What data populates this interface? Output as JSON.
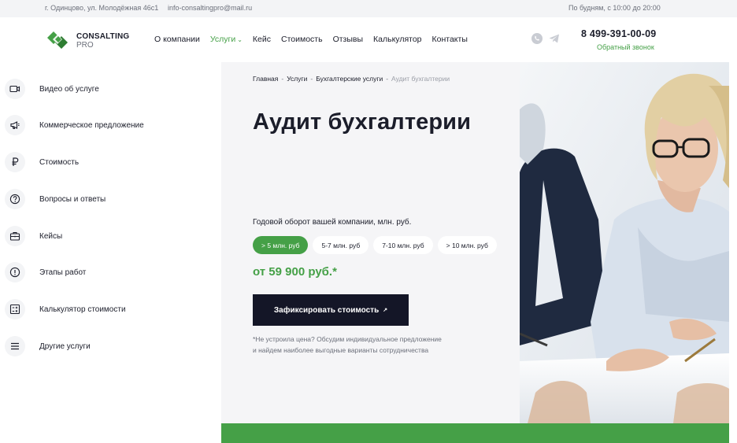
{
  "topbar": {
    "address": "г. Одинцово, ул. Молодёжная 46с1",
    "email": "info-consaltingpro@mail.ru",
    "hours": "По будням, с 10:00 до 20:00"
  },
  "logo": {
    "line1": "CONSALTING",
    "line2": "PRO"
  },
  "nav": {
    "items": [
      {
        "label": "О компании"
      },
      {
        "label": "Услуги",
        "active": true
      },
      {
        "label": "Кейс"
      },
      {
        "label": "Стоимость"
      },
      {
        "label": "Отзывы"
      },
      {
        "label": "Калькулятор"
      },
      {
        "label": "Контакты"
      }
    ]
  },
  "contact": {
    "phone": "8 499-391-00-09",
    "callback": "Обратный звонок"
  },
  "sidebar": {
    "items": [
      {
        "label": "Видео об услуге",
        "icon": "video-icon"
      },
      {
        "label": "Коммерческое предложение",
        "icon": "megaphone-icon"
      },
      {
        "label": "Стоимость",
        "icon": "ruble-icon"
      },
      {
        "label": "Вопросы и ответы",
        "icon": "question-icon"
      },
      {
        "label": "Кейсы",
        "icon": "briefcase-icon"
      },
      {
        "label": "Этапы работ",
        "icon": "info-icon"
      },
      {
        "label": "Калькулятор стоимости",
        "icon": "calculator-icon"
      },
      {
        "label": "Другие услуги",
        "icon": "menu-icon"
      }
    ]
  },
  "breadcrumbs": [
    "Главная",
    "Услуги",
    "Бухгалтерские услуги",
    "Аудит бухгалтерии"
  ],
  "hero": {
    "title": "Аудит бухгалтерии",
    "turnover_label": "Годовой оборот вашей компании, млн. руб.",
    "options": [
      "> 5 млн. руб",
      "5-7 млн. руб",
      "7-10 млн. руб",
      "> 10 млн. руб"
    ],
    "selected_option": 0,
    "price": "от 59 900 руб.*",
    "cta_label": "Зафиксировать стоимость",
    "note_line1": "*Не устроила цена? Обсудим индивидуальное предложение",
    "note_line2": "и найдем наиболее выгодные варианты сотрудничества"
  },
  "colors": {
    "accent": "#45a047",
    "dark": "#141627",
    "card_bg": "#f5f5f7"
  }
}
